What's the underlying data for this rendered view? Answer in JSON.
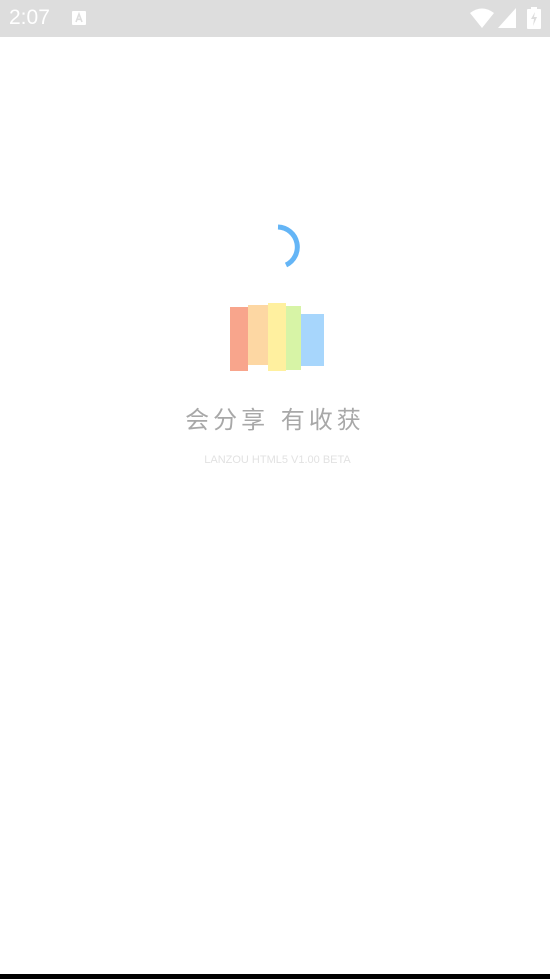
{
  "status_bar": {
    "time": "2:07",
    "background": "#dddddd",
    "icons": [
      "notification-a-icon",
      "wifi-icon",
      "signal-icon",
      "battery-charging-icon"
    ]
  },
  "splash": {
    "slogan": "会分享 有收获",
    "version": "LANZOU HTML5 V1.00 BETA",
    "spinner_color": "#64b5f6",
    "logo_colors": [
      "#f8a58c",
      "#fdd7a3",
      "#fff09f",
      "#d7f4a6",
      "#a7d6fc"
    ]
  }
}
